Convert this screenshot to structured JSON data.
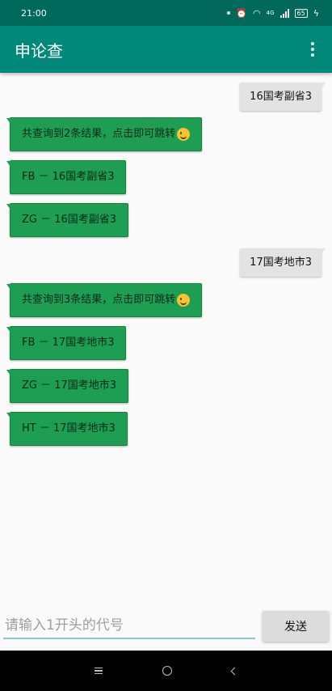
{
  "status_bar": {
    "time": "21:00",
    "network": "4G",
    "battery": "65"
  },
  "app_bar": {
    "title": "申论查",
    "menu_icon": "more-vert-icon"
  },
  "messages": [
    {
      "sender": "user",
      "text": "16国考副省3"
    },
    {
      "sender": "bot",
      "text": "共查询到2条结果，点击即可跳转",
      "emoji": "wink-emoji"
    },
    {
      "sender": "bot",
      "text": "FB － 16国考副省3"
    },
    {
      "sender": "bot",
      "text": "ZG － 16国考副省3"
    },
    {
      "sender": "user",
      "text": "17国考地市3"
    },
    {
      "sender": "bot",
      "text": "共查询到3条结果，点击即可跳转",
      "emoji": "wink-emoji"
    },
    {
      "sender": "bot",
      "text": "FB － 17国考地市3"
    },
    {
      "sender": "bot",
      "text": "ZG － 17国考地市3"
    },
    {
      "sender": "bot",
      "text": "HT － 17国考地市3"
    }
  ],
  "input": {
    "value": "",
    "placeholder": "请输入1开头的代号",
    "send_label": "发送"
  },
  "colors": {
    "status_bar": "#00695c",
    "app_bar": "#00897b",
    "bot_bubble": "#1e9e52",
    "user_bubble": "#e3e3e3"
  }
}
